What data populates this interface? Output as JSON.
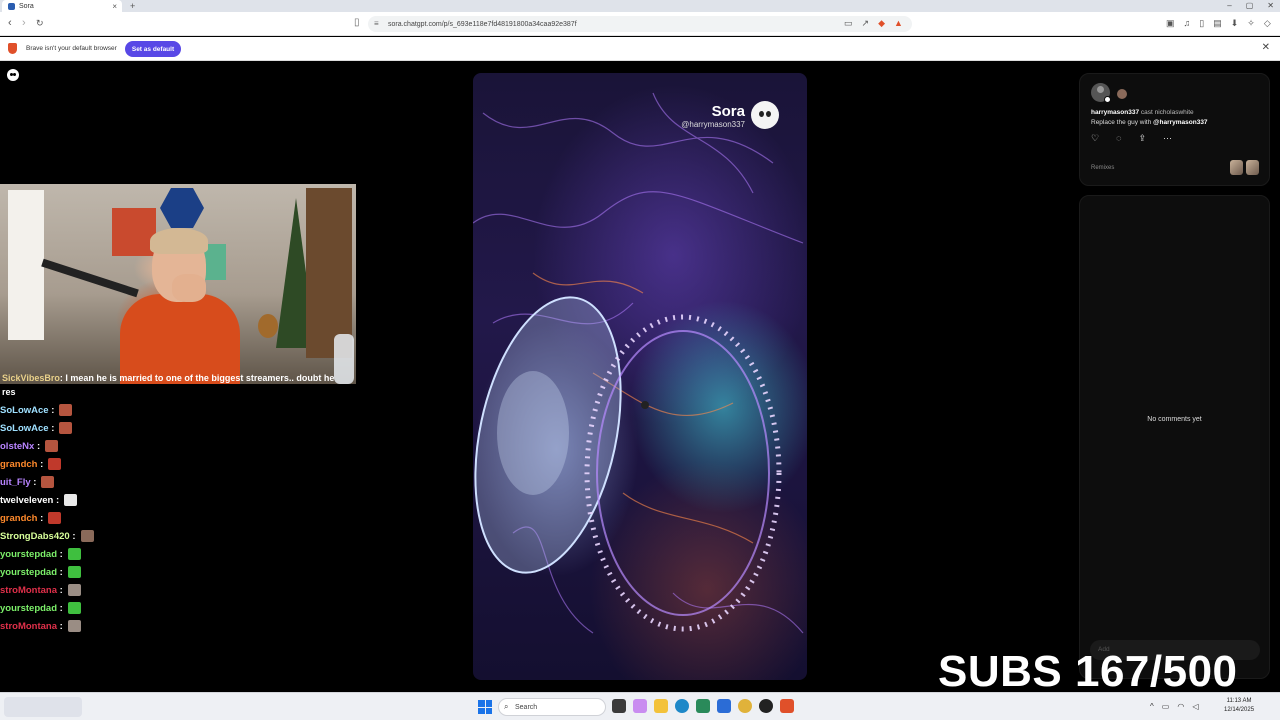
{
  "browser": {
    "tab_title": "Sora",
    "url": "sora.chatgpt.com/p/s_693e118e7fd48191800a34caa92e387f",
    "infobar_message": "Brave isn't your default browser",
    "infobar_button": "Set as default"
  },
  "video": {
    "watermark_title": "Sora",
    "watermark_user": "@harrymason337"
  },
  "post": {
    "author": "harrymason337",
    "caption_rest": "cast nicholaswhite",
    "prompt_text": "Replace the guy with",
    "prompt_mention": "@harrymason337",
    "remixes_label": "Remixes",
    "actions": [
      "like-icon",
      "comment-icon",
      "share-icon",
      "more-icon"
    ]
  },
  "comments": {
    "empty_text": "No comments yet",
    "input_placeholder": "Add"
  },
  "chat": {
    "cut_name": "SickVibesBro",
    "cut_text": ": I mean he is married to one of the biggest streamers.. doubt he",
    "cut_tail": "res",
    "messages": [
      {
        "user": "SoLowAce",
        "color": "#9fe0ff",
        "emote": "#b5553f"
      },
      {
        "user": "SoLowAce",
        "color": "#9fe0ff",
        "emote": "#b5553f"
      },
      {
        "user": "olsteNx",
        "color": "#b884ff",
        "emote": "#b5553f"
      },
      {
        "user": "grandch",
        "color": "#ff8a2c",
        "emote": "#c0392b"
      },
      {
        "user": "uit_Fly",
        "color": "#b884ff",
        "emote": "#b5553f"
      },
      {
        "user": "twelveleven",
        "color": "#ffffff",
        "emote": "#e9e9e9"
      },
      {
        "user": "grandch",
        "color": "#ff8a2c",
        "emote": "#c0392b"
      },
      {
        "user": "StrongDabs420",
        "color": "#d7ff9a",
        "emote": "#8a6a5a"
      },
      {
        "user": "yourstepdad",
        "color": "#7cf06a",
        "emote": "#3fbf3f"
      },
      {
        "user": "yourstepdad",
        "color": "#7cf06a",
        "emote": "#3fbf3f"
      },
      {
        "user": "stroMontana",
        "color": "#e0304a",
        "emote": "#9a8d84"
      },
      {
        "user": "yourstepdad",
        "color": "#7cf06a",
        "emote": "#3fbf3f"
      },
      {
        "user": "stroMontana",
        "color": "#e0304a",
        "emote": "#9a8d84"
      }
    ]
  },
  "overlay": {
    "subs_text": "SUBS 167/500"
  },
  "taskbar": {
    "search_placeholder": "Search",
    "time": "11:13 AM",
    "date": "12/14/2025"
  }
}
